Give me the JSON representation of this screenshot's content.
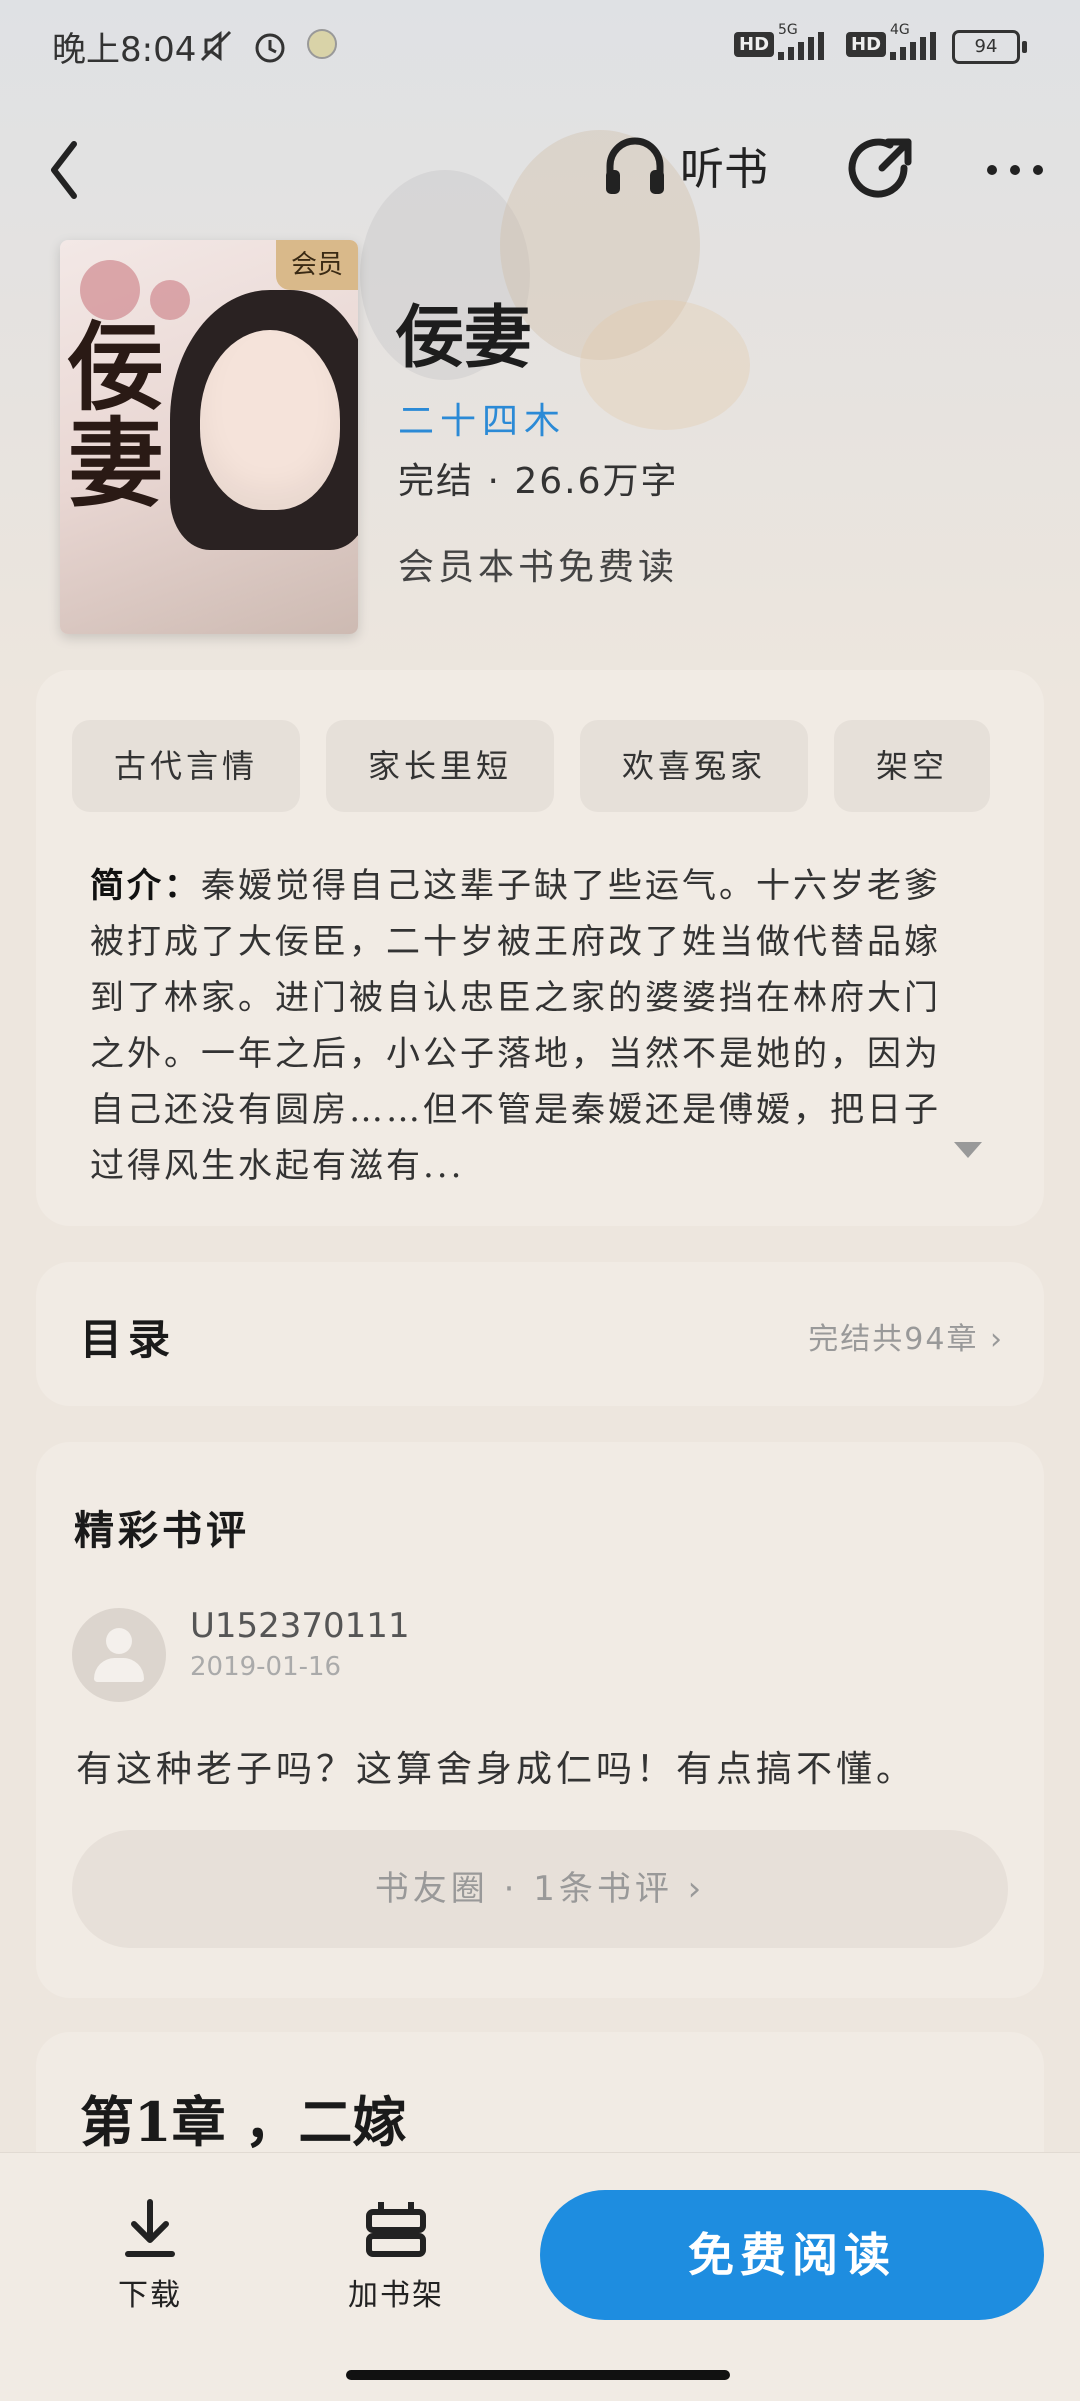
{
  "status_bar": {
    "time": "晚上8:04",
    "network_1": "5G",
    "network_2": "4G",
    "hd_1": "HD",
    "hd_2": "HD",
    "battery": "94"
  },
  "nav": {
    "listen_label": "听书"
  },
  "book": {
    "cover_badge": "会员",
    "cover_art_title": "佞妻",
    "title": "佞妻",
    "author": "二十四木",
    "meta": "完结 · 26.6万字",
    "vip_note": "会员本书免费读"
  },
  "tags": [
    "古代言情",
    "家长里短",
    "欢喜冤家",
    "架空"
  ],
  "intro": {
    "label": "简介：",
    "text": "秦嫒觉得自己这辈子缺了些运气。十六岁老爹被打成了大佞臣，二十岁被王府改了姓当做代替品嫁到了林家。进门被自认忠臣之家的婆婆挡在林府大门之外。一年之后，小公子落地，当然不是她的，因为自己还没有圆房……但不管是秦嫒还是傅嫒，把日子过得风生水起有滋有..."
  },
  "toc": {
    "title": "目录",
    "info": "完结共94章 ›"
  },
  "reviews": {
    "title": "精彩书评",
    "user": "U152370111",
    "date": "2019-01-16",
    "text": "有这种老子吗？这算舍身成仁吗！有点搞不懂。",
    "circle_link": "书友圈  ·  1条书评 ›"
  },
  "chapter_preview": "第1章  ，二嫁",
  "bottom_bar": {
    "download": "下载",
    "add_shelf": "加书架",
    "read_free": "免费阅读"
  },
  "colors": {
    "accent": "#1e8de0",
    "author": "#2b8ad6",
    "background": "#ede6de",
    "card": "#f1ebe4"
  }
}
